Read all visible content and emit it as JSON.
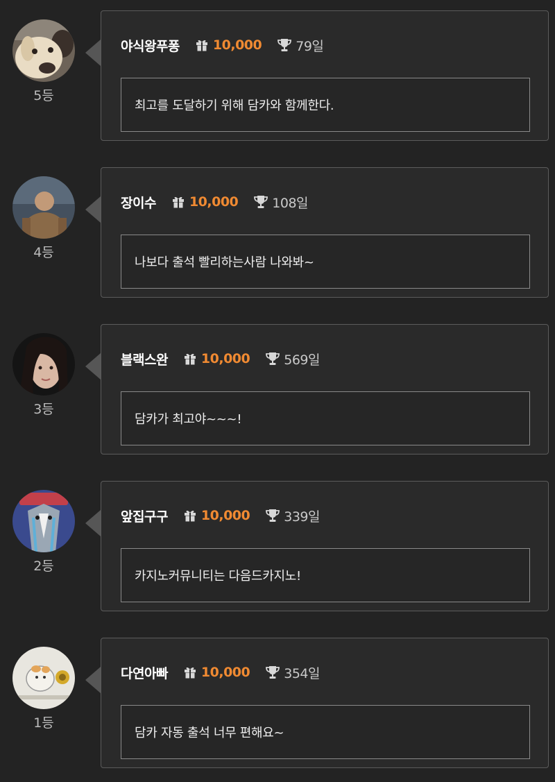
{
  "attendance": [
    {
      "rank": "5등",
      "nickname": "야식왕푸퐁",
      "points": "10,000",
      "days": "79일",
      "message": "최고를 도달하기 위해 담카와 함께한다.",
      "avatar_icon": "dog-avatar-icon"
    },
    {
      "rank": "4등",
      "nickname": "장이수",
      "points": "10,000",
      "days": "108일",
      "message": "나보다 출석 빨리하는사람 나와봐~",
      "avatar_icon": "person-avatar-icon"
    },
    {
      "rank": "3등",
      "nickname": "블랙스완",
      "points": "10,000",
      "days": "569일",
      "message": "담카가 최고야~~~!",
      "avatar_icon": "woman-portrait-avatar-icon"
    },
    {
      "rank": "2등",
      "nickname": "앞집구구",
      "points": "10,000",
      "days": "339일",
      "message": "카지노커뮤니티는 다음드카지노!",
      "avatar_icon": "cartoon-avatar-icon"
    },
    {
      "rank": "1등",
      "nickname": "다연아빠",
      "points": "10,000",
      "days": "354일",
      "message": "담카 자동 출석 너무 편해요~",
      "avatar_icon": "hamster-drawing-avatar-icon"
    }
  ],
  "colors": {
    "background": "#232323",
    "points_accent": "#f08a32",
    "card_border": "#5c5c5c"
  }
}
